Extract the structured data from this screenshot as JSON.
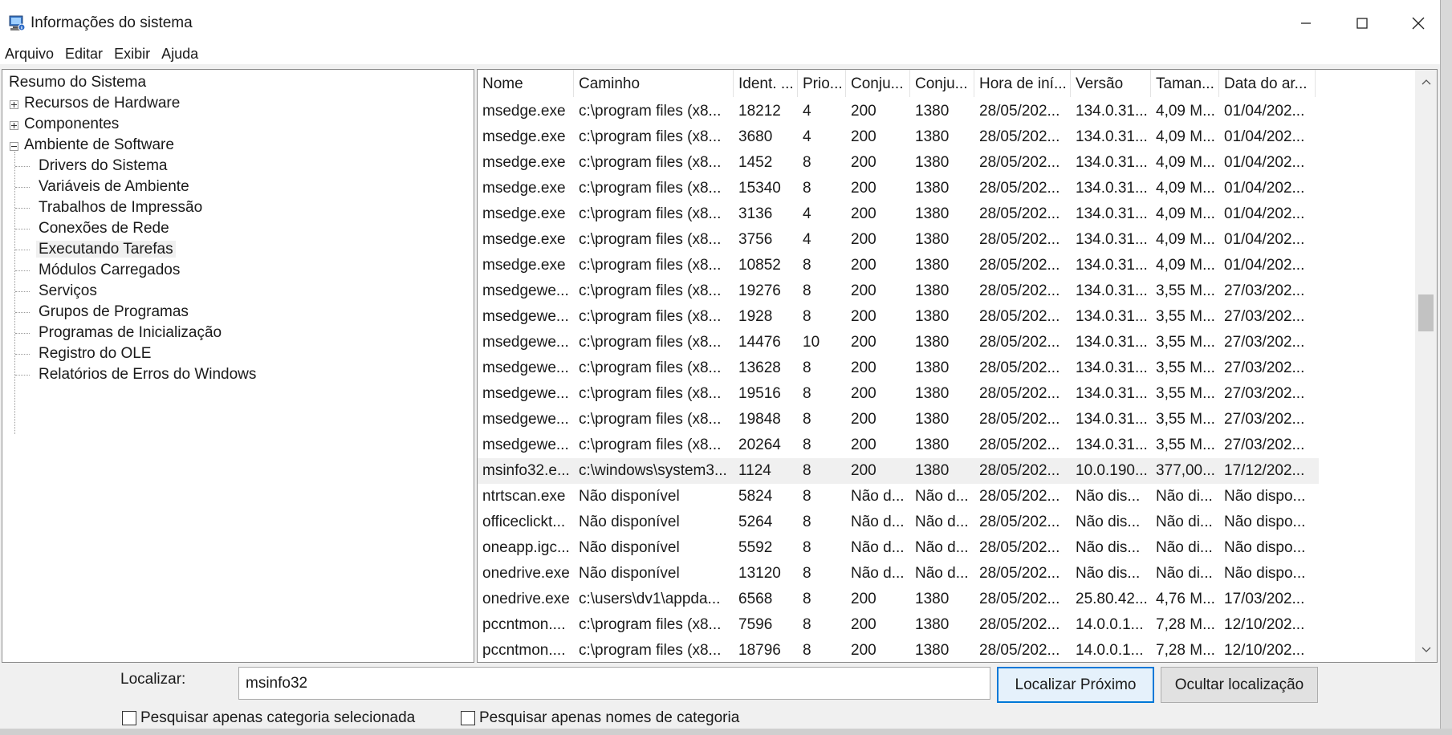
{
  "window": {
    "title": "Informações do sistema"
  },
  "menu": [
    "Arquivo",
    "Editar",
    "Exibir",
    "Ajuda"
  ],
  "tree": {
    "root": "Resumo do Sistema",
    "nodes": [
      {
        "label": "Recursos de Hardware",
        "expander": "plus"
      },
      {
        "label": "Componentes",
        "expander": "plus"
      },
      {
        "label": "Ambiente de Software",
        "expander": "minus"
      }
    ],
    "children": [
      "Drivers do Sistema",
      "Variáveis de Ambiente",
      "Trabalhos de Impressão",
      "Conexões de Rede",
      "Executando Tarefas",
      "Módulos Carregados",
      "Serviços",
      "Grupos de Programas",
      "Programas de Inicialização",
      "Registro do OLE",
      "Relatórios de Erros do Windows"
    ],
    "selected": "Executando Tarefas"
  },
  "table": {
    "columns": [
      "Nome",
      "Caminho",
      "Ident. ...",
      "Prio...",
      "Conju...",
      "Conju...",
      "Hora de iní...",
      "Versão",
      "Taman...",
      "Data do ar..."
    ],
    "rows": [
      [
        "msedge.exe",
        "c:\\program files (x8...",
        "18212",
        "4",
        "200",
        "1380",
        "28/05/202...",
        "134.0.31...",
        "4,09 M...",
        "01/04/202..."
      ],
      [
        "msedge.exe",
        "c:\\program files (x8...",
        "3680",
        "4",
        "200",
        "1380",
        "28/05/202...",
        "134.0.31...",
        "4,09 M...",
        "01/04/202..."
      ],
      [
        "msedge.exe",
        "c:\\program files (x8...",
        "1452",
        "8",
        "200",
        "1380",
        "28/05/202...",
        "134.0.31...",
        "4,09 M...",
        "01/04/202..."
      ],
      [
        "msedge.exe",
        "c:\\program files (x8...",
        "15340",
        "8",
        "200",
        "1380",
        "28/05/202...",
        "134.0.31...",
        "4,09 M...",
        "01/04/202..."
      ],
      [
        "msedge.exe",
        "c:\\program files (x8...",
        "3136",
        "4",
        "200",
        "1380",
        "28/05/202...",
        "134.0.31...",
        "4,09 M...",
        "01/04/202..."
      ],
      [
        "msedge.exe",
        "c:\\program files (x8...",
        "3756",
        "4",
        "200",
        "1380",
        "28/05/202...",
        "134.0.31...",
        "4,09 M...",
        "01/04/202..."
      ],
      [
        "msedge.exe",
        "c:\\program files (x8...",
        "10852",
        "8",
        "200",
        "1380",
        "28/05/202...",
        "134.0.31...",
        "4,09 M...",
        "01/04/202..."
      ],
      [
        "msedgewe...",
        "c:\\program files (x8...",
        "19276",
        "8",
        "200",
        "1380",
        "28/05/202...",
        "134.0.31...",
        "3,55 M...",
        "27/03/202..."
      ],
      [
        "msedgewe...",
        "c:\\program files (x8...",
        "1928",
        "8",
        "200",
        "1380",
        "28/05/202...",
        "134.0.31...",
        "3,55 M...",
        "27/03/202..."
      ],
      [
        "msedgewe...",
        "c:\\program files (x8...",
        "14476",
        "10",
        "200",
        "1380",
        "28/05/202...",
        "134.0.31...",
        "3,55 M...",
        "27/03/202..."
      ],
      [
        "msedgewe...",
        "c:\\program files (x8...",
        "13628",
        "8",
        "200",
        "1380",
        "28/05/202...",
        "134.0.31...",
        "3,55 M...",
        "27/03/202..."
      ],
      [
        "msedgewe...",
        "c:\\program files (x8...",
        "19516",
        "8",
        "200",
        "1380",
        "28/05/202...",
        "134.0.31...",
        "3,55 M...",
        "27/03/202..."
      ],
      [
        "msedgewe...",
        "c:\\program files (x8...",
        "19848",
        "8",
        "200",
        "1380",
        "28/05/202...",
        "134.0.31...",
        "3,55 M...",
        "27/03/202..."
      ],
      [
        "msedgewe...",
        "c:\\program files (x8...",
        "20264",
        "8",
        "200",
        "1380",
        "28/05/202...",
        "134.0.31...",
        "3,55 M...",
        "27/03/202..."
      ],
      [
        "msinfo32.e...",
        "c:\\windows\\system3...",
        "1124",
        "8",
        "200",
        "1380",
        "28/05/202...",
        "10.0.190...",
        "377,00...",
        "17/12/202..."
      ],
      [
        "ntrtscan.exe",
        "Não disponível",
        "5824",
        "8",
        "Não d...",
        "Não d...",
        "28/05/202...",
        "Não dis...",
        "Não di...",
        "Não dispo..."
      ],
      [
        "officeclickt...",
        "Não disponível",
        "5264",
        "8",
        "Não d...",
        "Não d...",
        "28/05/202...",
        "Não dis...",
        "Não di...",
        "Não dispo..."
      ],
      [
        "oneapp.igc...",
        "Não disponível",
        "5592",
        "8",
        "Não d...",
        "Não d...",
        "28/05/202...",
        "Não dis...",
        "Não di...",
        "Não dispo..."
      ],
      [
        "onedrive.exe",
        "Não disponível",
        "13120",
        "8",
        "Não d...",
        "Não d...",
        "28/05/202...",
        "Não dis...",
        "Não di...",
        "Não dispo..."
      ],
      [
        "onedrive.exe",
        "c:\\users\\dv1\\appda...",
        "6568",
        "8",
        "200",
        "1380",
        "28/05/202...",
        "25.80.42...",
        "4,76 M...",
        "17/03/202..."
      ],
      [
        "pccntmon....",
        "c:\\program files (x8...",
        "7596",
        "8",
        "200",
        "1380",
        "28/05/202...",
        "14.0.0.1...",
        "7,28 M...",
        "12/10/202..."
      ],
      [
        "pccntmon....",
        "c:\\program files (x8...",
        "18796",
        "8",
        "200",
        "1380",
        "28/05/202...",
        "14.0.0.1...",
        "7,28 M...",
        "12/10/202..."
      ]
    ],
    "highlighted_row": 14
  },
  "find": {
    "label": "Localizar:",
    "value": "msinfo32",
    "find_next": "Localizar Próximo",
    "hide_find": "Ocultar localização",
    "check_selected_category": "Pesquisar apenas categoria selecionada",
    "check_category_names": "Pesquisar apenas nomes de categoria"
  },
  "icons": {
    "app": "system-info-icon",
    "minimize": "minimize-icon",
    "maximize": "maximize-icon",
    "close": "close-icon",
    "scroll_up": "scroll-up-icon",
    "scroll_down": "scroll-down-icon"
  },
  "colors": {
    "selection_bg": "#f0f0f0",
    "primary_button_border": "#0078d7"
  }
}
